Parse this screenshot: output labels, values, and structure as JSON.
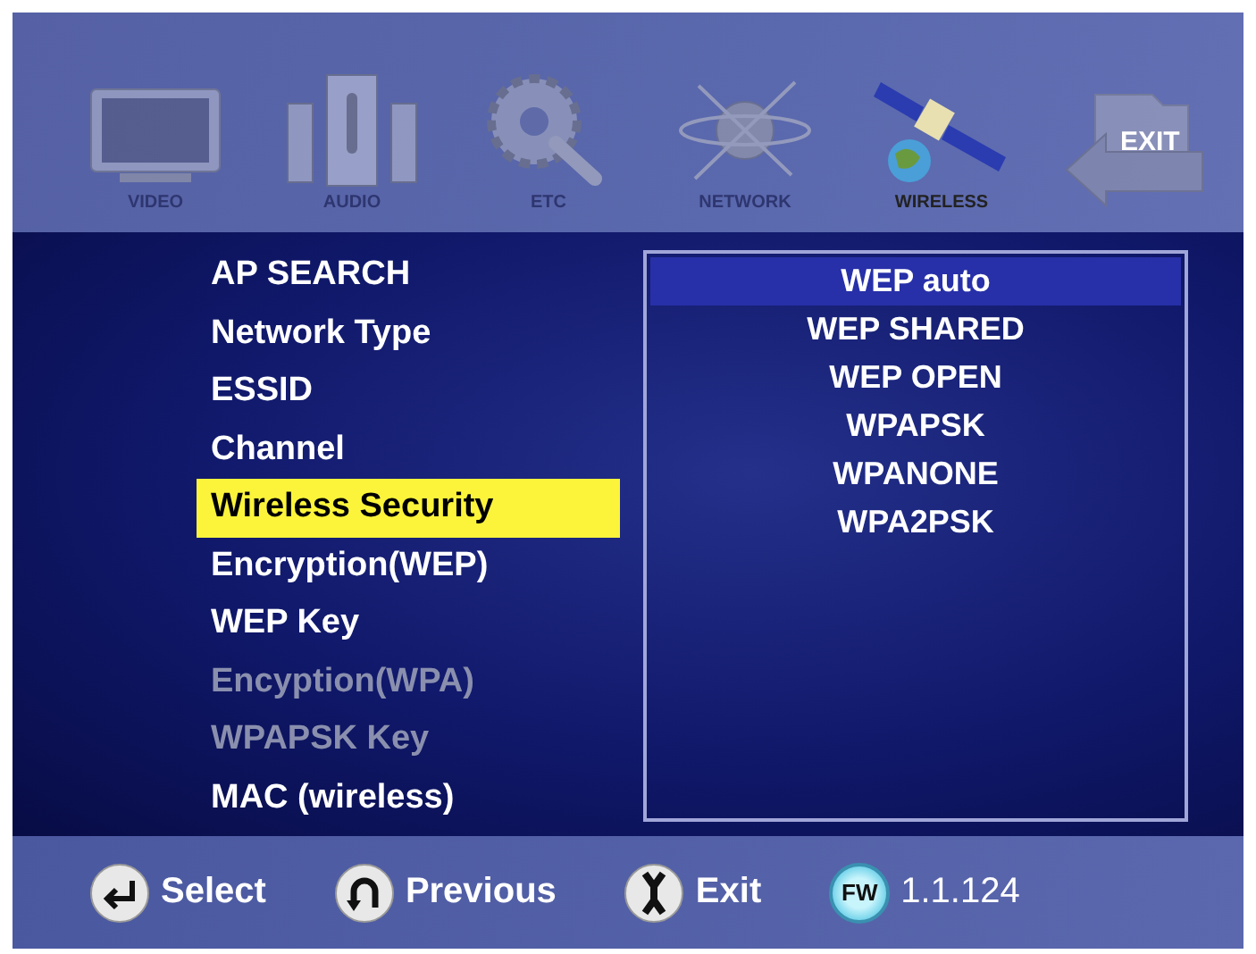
{
  "categories": [
    {
      "kind": "tv",
      "label": "VIDEO",
      "selected": false
    },
    {
      "kind": "speakers",
      "label": "AUDIO",
      "selected": false
    },
    {
      "kind": "gear",
      "label": "ETC",
      "selected": false
    },
    {
      "kind": "network",
      "label": "NETWORK",
      "selected": false
    },
    {
      "kind": "satellite",
      "label": "WIRELESS",
      "selected": true
    },
    {
      "kind": "exit",
      "label": "EXIT",
      "selected": false
    }
  ],
  "menu": [
    {
      "label": "AP SEARCH",
      "selected": false,
      "disabled": false
    },
    {
      "label": "Network Type",
      "selected": false,
      "disabled": false
    },
    {
      "label": "ESSID",
      "selected": false,
      "disabled": false
    },
    {
      "label": "Channel",
      "selected": false,
      "disabled": false
    },
    {
      "label": "Wireless Security",
      "selected": true,
      "disabled": false
    },
    {
      "label": "Encryption(WEP)",
      "selected": false,
      "disabled": false
    },
    {
      "label": "WEP Key",
      "selected": false,
      "disabled": false
    },
    {
      "label": "Encyption(WPA)",
      "selected": false,
      "disabled": true
    },
    {
      "label": "WPAPSK Key",
      "selected": false,
      "disabled": true
    },
    {
      "label": "MAC (wireless)",
      "selected": false,
      "disabled": false
    }
  ],
  "options": [
    {
      "label": "WEP auto",
      "selected": true
    },
    {
      "label": "WEP SHARED",
      "selected": false
    },
    {
      "label": "WEP OPEN",
      "selected": false
    },
    {
      "label": "WPAPSK",
      "selected": false
    },
    {
      "label": "WPANONE",
      "selected": false
    },
    {
      "label": "WPA2PSK",
      "selected": false
    }
  ],
  "footer": [
    {
      "kind": "enter",
      "label": "Select"
    },
    {
      "kind": "back",
      "label": "Previous"
    },
    {
      "kind": "tool",
      "label": "Exit"
    },
    {
      "kind": "fw",
      "badge": "FW",
      "label": "1.1.124"
    }
  ]
}
